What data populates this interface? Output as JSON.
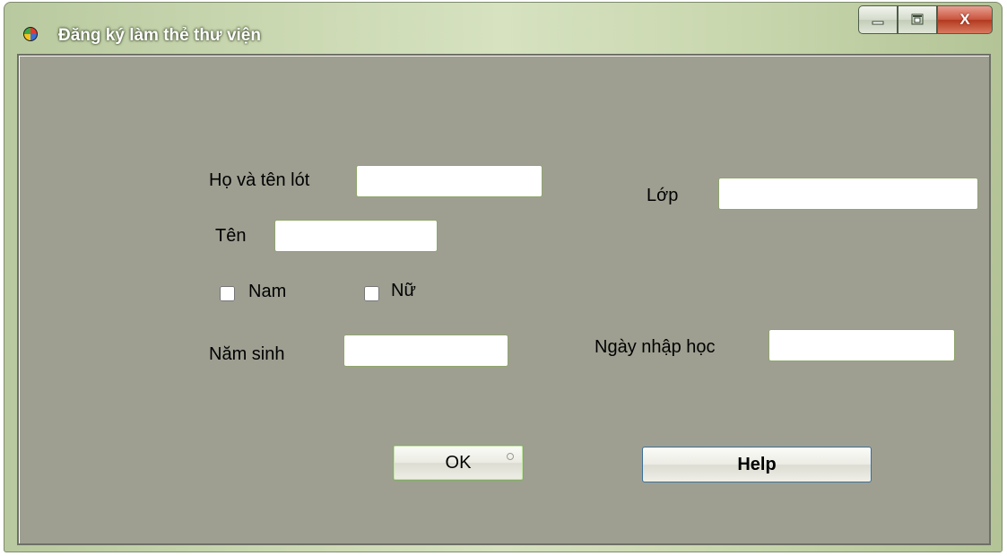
{
  "window": {
    "title": "Đăng ký làm thẻ thư viện",
    "controls": {
      "minimize": "minimize",
      "maximize": "maximize",
      "close": "X"
    }
  },
  "form": {
    "ho_ten_lot_label": "Họ và tên lót",
    "ho_ten_lot_value": "",
    "ten_label": "Tên",
    "ten_value": "",
    "lop_label": "Lớp",
    "lop_value": "",
    "nam_label": "Nam",
    "nam_checked": false,
    "nu_label": "Nữ",
    "nu_checked": false,
    "nam_sinh_label": "Năm sinh",
    "nam_sinh_value": "",
    "ngay_nhap_hoc_label": "Ngày nhập học",
    "ngay_nhap_hoc_value": ""
  },
  "buttons": {
    "ok_label": "OK",
    "help_label": "Help"
  },
  "icons": {
    "app": "app-icon",
    "minimize": "minimize-icon",
    "maximize": "maximize-icon",
    "close": "close-icon"
  },
  "colors": {
    "client_bg": "#9e9f91",
    "titlebar": "#c9d7b0",
    "close_button": "#c9533c"
  }
}
